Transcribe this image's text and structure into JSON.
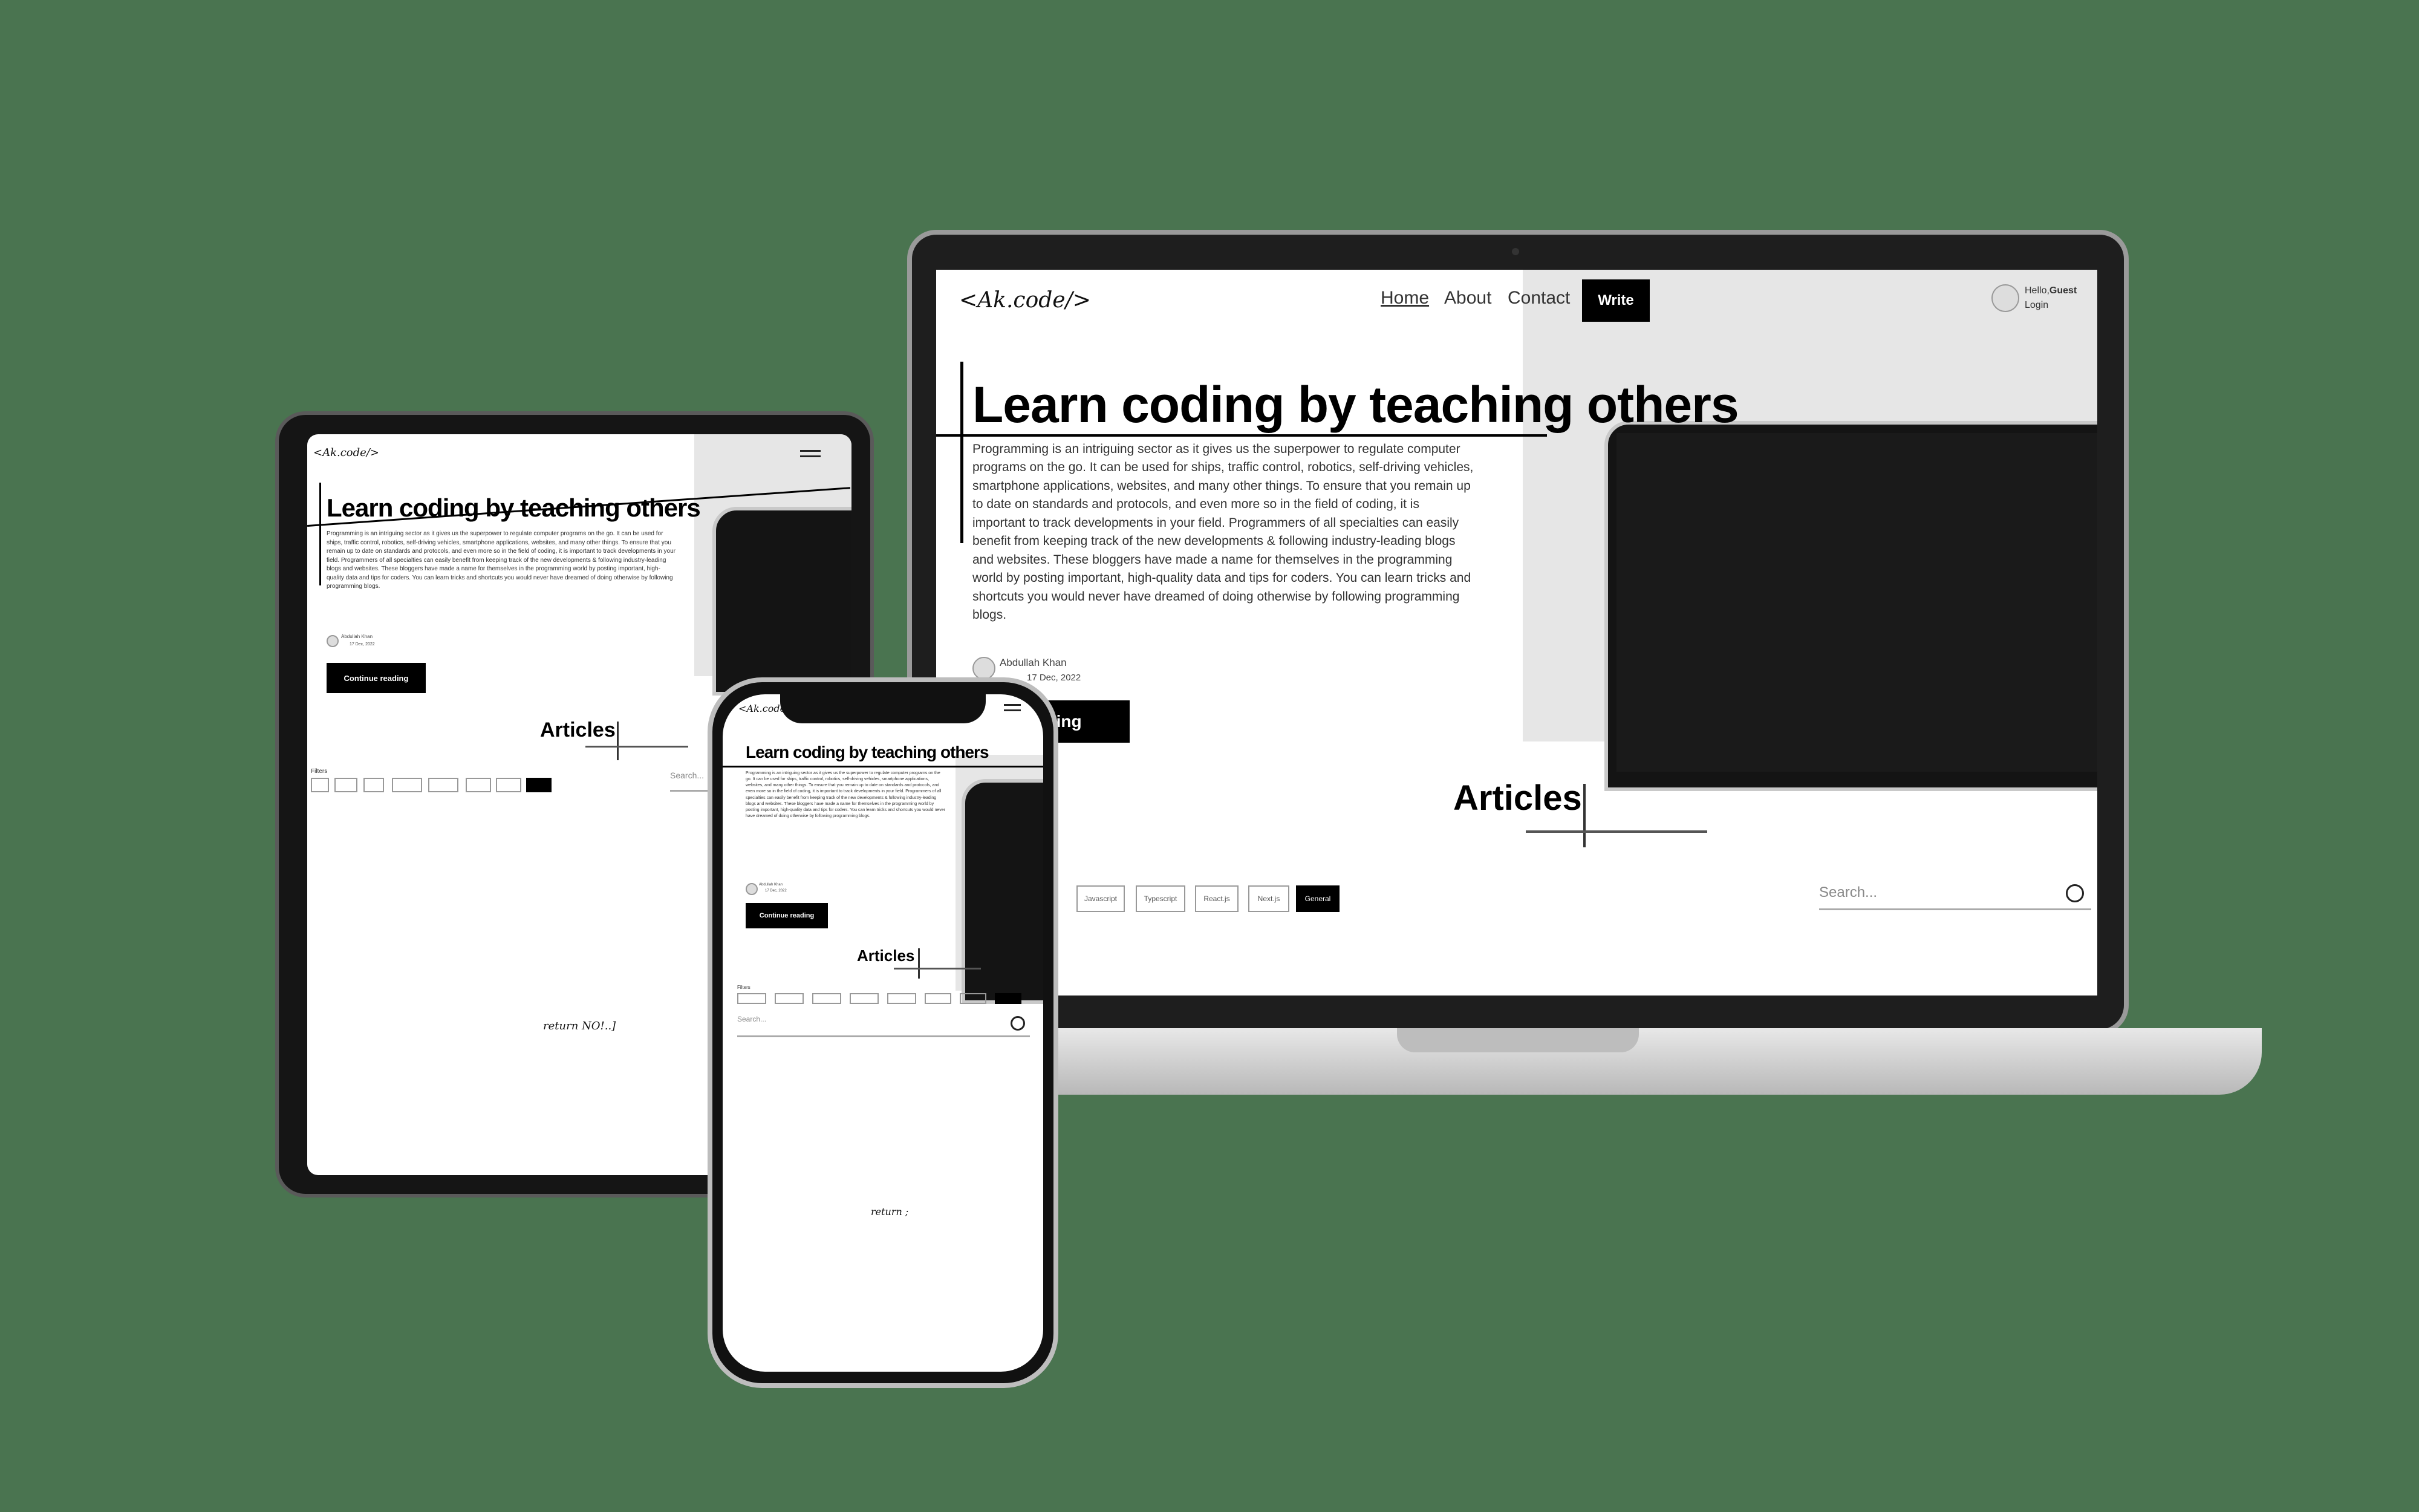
{
  "site": {
    "logo": "<Ak.code/>",
    "nav": [
      "Home",
      "About",
      "Contact"
    ],
    "write_label": "Write",
    "user_greeting": "Hello,",
    "user_name": "Guest",
    "login_label": "Login"
  },
  "hero": {
    "title": "Learn coding by teaching others",
    "body": "Programming is an intriguing sector as it gives us the superpower to regulate computer programs on the go. It can be used for ships, traffic control, robotics, self-driving vehicles, smartphone applications, websites, and many other things. To ensure that you remain up to date on standards and protocols, and even more so in the field of coding, it is important to track developments in your field. Programmers of all specialties can easily benefit from keeping track of the new developments & following industry-leading blogs and websites. These bloggers have made a name for themselves in the programming world by posting important, high-quality data and tips for coders. You can learn tricks and shortcuts you would never have dreamed of doing otherwise by following programming blogs.",
    "author": "Abdullah Khan",
    "date": "17 Dec, 2022",
    "cta_visible": "reading",
    "cta_full": "Continue reading"
  },
  "articles": {
    "heading": "Articles",
    "filters_label": "Filters",
    "chips": [
      "Javascript",
      "Typescript",
      "React.js",
      "Next.js",
      "General"
    ],
    "chips_partial_first": "",
    "search_placeholder": "Search...",
    "selected_chip": "General"
  },
  "tablet": {
    "footer_text": "return NO!..]"
  },
  "phone": {
    "footer_text": "return ;"
  }
}
